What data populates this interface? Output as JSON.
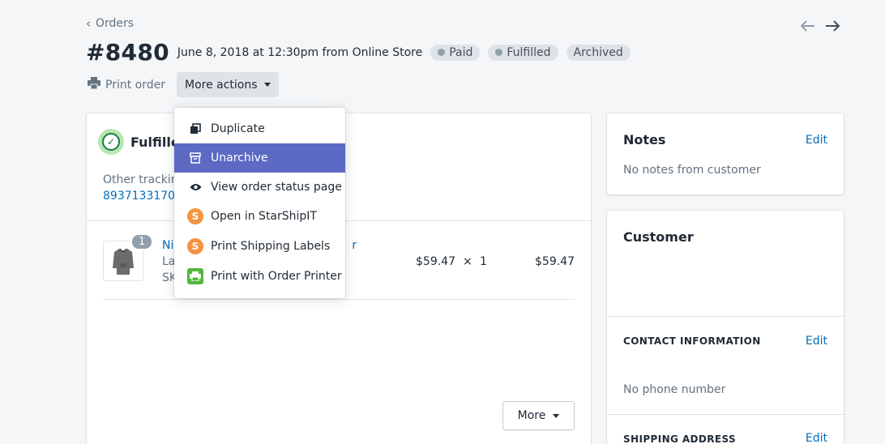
{
  "nav": {
    "back_label": "Orders"
  },
  "order": {
    "number": "#8480",
    "date_line": "June 8, 2018 at 12:30pm from Online Store",
    "badges": [
      {
        "label": "Paid",
        "dot": true
      },
      {
        "label": "Fulfilled",
        "dot": true
      },
      {
        "label": "Archived",
        "dot": false
      }
    ]
  },
  "actions": {
    "print_label": "Print order",
    "more_label": "More actions"
  },
  "menu": {
    "items": [
      {
        "label": "Duplicate",
        "icon": "duplicate-icon"
      },
      {
        "label": "Unarchive",
        "icon": "archive-icon",
        "active": true
      },
      {
        "label": "View order status page",
        "icon": "eye-icon"
      },
      {
        "label": "Open in StarShipIT",
        "icon": "starshipit-icon"
      },
      {
        "label": "Print Shipping Labels",
        "icon": "starshipit-icon"
      },
      {
        "label": "Print with Order Printer",
        "icon": "order-printer-icon"
      }
    ]
  },
  "fulfillment": {
    "title": "Fulfilled",
    "tracking_label": "Other tracking",
    "tracking_number": "89371331700",
    "item": {
      "quantity_badge": "1",
      "name": "Ni",
      "name_tail": "r",
      "variant": "La",
      "sku": "SK",
      "price": "$59.47",
      "times": "×",
      "qty": "1",
      "total": "$59.47"
    },
    "more_button": "More"
  },
  "notes": {
    "title": "Notes",
    "edit": "Edit",
    "body": "No notes from customer"
  },
  "customer": {
    "title": "Customer",
    "contact_heading": "CONTACT INFORMATION",
    "contact_edit": "Edit",
    "phone": "No phone number",
    "shipping_heading": "SHIPPING ADDRESS",
    "shipping_edit": "Edit"
  },
  "colors": {
    "accent": "#5c6ac4",
    "link": "#006fbb",
    "success": "#108043"
  }
}
